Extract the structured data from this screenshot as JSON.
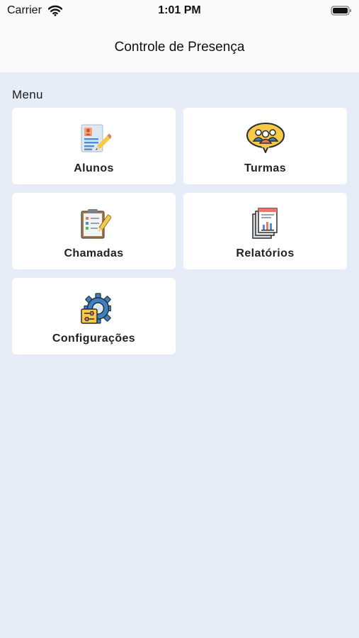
{
  "status_bar": {
    "carrier": "Carrier",
    "time": "1:01 PM",
    "wifi_icon": "wifi-icon",
    "battery_icon": "battery-icon"
  },
  "nav": {
    "title": "Controle de Presença"
  },
  "menu": {
    "section_title": "Menu",
    "items": [
      {
        "label": "Alunos",
        "icon": "student-list-icon"
      },
      {
        "label": "Turmas",
        "icon": "group-chat-icon"
      },
      {
        "label": "Chamadas",
        "icon": "clipboard-checklist-icon"
      },
      {
        "label": "Relatórios",
        "icon": "report-documents-icon"
      },
      {
        "label": "Configurações",
        "icon": "settings-gear-icon"
      }
    ]
  },
  "colors": {
    "background": "#e6edf8",
    "card": "#ffffff",
    "bar": "#fbf9fc"
  }
}
